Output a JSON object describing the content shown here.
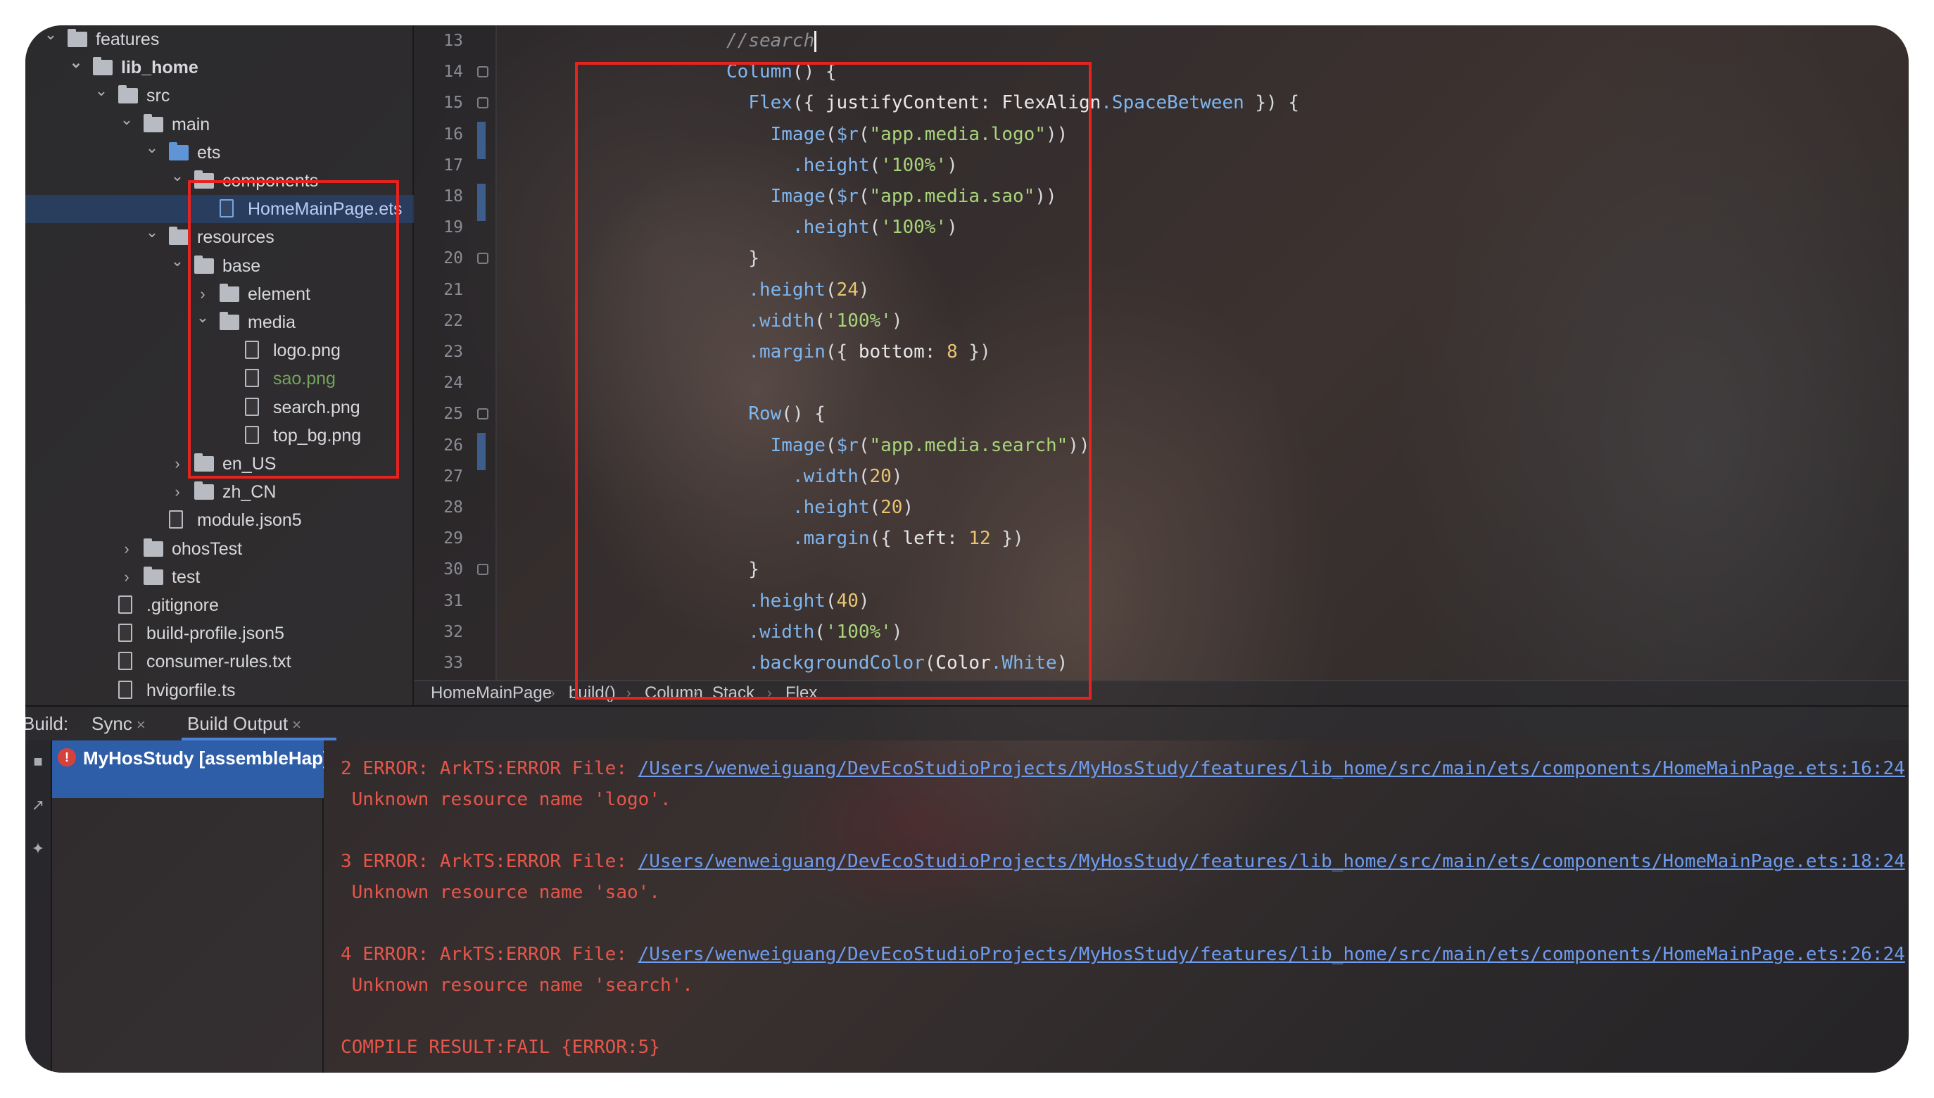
{
  "project_tree": {
    "items": [
      {
        "label": "features",
        "kind": "folder",
        "chev": "down"
      },
      {
        "label": "lib_home",
        "kind": "module-folder",
        "chev": "down"
      },
      {
        "label": "src",
        "kind": "folder",
        "chev": "down"
      },
      {
        "label": "main",
        "kind": "folder",
        "chev": "down"
      },
      {
        "label": "ets",
        "kind": "blue-folder",
        "chev": "down"
      },
      {
        "label": "components",
        "kind": "folder",
        "chev": "down"
      },
      {
        "label": "HomeMainPage.ets",
        "kind": "ets-file",
        "chev": ""
      },
      {
        "label": "resources",
        "kind": "folder",
        "chev": "down"
      },
      {
        "label": "base",
        "kind": "folder",
        "chev": "down"
      },
      {
        "label": "element",
        "kind": "folder",
        "chev": "right"
      },
      {
        "label": "media",
        "kind": "folder",
        "chev": "down"
      },
      {
        "label": "logo.png",
        "kind": "file",
        "chev": ""
      },
      {
        "label": "sao.png",
        "kind": "file",
        "chev": ""
      },
      {
        "label": "search.png",
        "kind": "file",
        "chev": ""
      },
      {
        "label": "top_bg.png",
        "kind": "file",
        "chev": ""
      },
      {
        "label": "en_US",
        "kind": "folder",
        "chev": "right"
      },
      {
        "label": "zh_CN",
        "kind": "folder",
        "chev": "right"
      },
      {
        "label": "module.json5",
        "kind": "file",
        "chev": ""
      },
      {
        "label": "ohosTest",
        "kind": "folder",
        "chev": "right"
      },
      {
        "label": "test",
        "kind": "folder",
        "chev": "right"
      },
      {
        "label": ".gitignore",
        "kind": "file",
        "chev": ""
      },
      {
        "label": "build-profile.json5",
        "kind": "file",
        "chev": ""
      },
      {
        "label": "consumer-rules.txt",
        "kind": "file",
        "chev": ""
      },
      {
        "label": "hvigorfile.ts",
        "kind": "file",
        "chev": ""
      }
    ]
  },
  "editor": {
    "line_numbers": [
      "13",
      "14",
      "15",
      "16",
      "17",
      "18",
      "19",
      "20",
      "21",
      "22",
      "23",
      "24",
      "25",
      "26",
      "27",
      "28",
      "29",
      "30",
      "31",
      "32",
      "33"
    ],
    "lines": [
      "//search",
      "Column() {",
      "  Flex({ justifyContent: FlexAlign.SpaceBetween }) {",
      "    Image($r(\"app.media.logo\"))",
      "      .height('100%')",
      "    Image($r(\"app.media.sao\"))",
      "      .height('100%')",
      "  }",
      "  .height(24)",
      "  .width('100%')",
      "  .margin({ bottom: 8 })",
      "",
      "  Row() {",
      "    Image($r(\"app.media.search\"))",
      "      .width(20)",
      "      .height(20)",
      "      .margin({ left: 12 })",
      "  }",
      "  .height(40)",
      "  .width('100%')",
      "  .backgroundColor(Color.White)"
    ]
  },
  "breadcrumb": [
    "HomeMainPage",
    "build()",
    "Column",
    "Stack",
    "Flex"
  ],
  "build_window": {
    "tabs": {
      "build_label": "Build:",
      "sync": "Sync",
      "build_output": "Build Output",
      "close": "×"
    },
    "task_label": "MyHosStudy [assembleHap]",
    "error_icon": "!",
    "console": {
      "errors": [
        {
          "prefix": "2 ERROR: ArkTS:ERROR File: ",
          "link": "/Users/wenweiguang/DevEcoStudioProjects/MyHosStudy/features/lib_home/src/main/ets/components/HomeMainPage.ets:16:24",
          "message": " Unknown resource name 'logo'."
        },
        {
          "prefix": "3 ERROR: ArkTS:ERROR File: ",
          "link": "/Users/wenweiguang/DevEcoStudioProjects/MyHosStudy/features/lib_home/src/main/ets/components/HomeMainPage.ets:18:24",
          "message": " Unknown resource name 'sao'."
        },
        {
          "prefix": "4 ERROR: ArkTS:ERROR File: ",
          "link": "/Users/wenweiguang/DevEcoStudioProjects/MyHosStudy/features/lib_home/src/main/ets/components/HomeMainPage.ets:26:24",
          "message": " Unknown resource name 'search'."
        }
      ],
      "result": "COMPILE RESULT:FAIL {ERROR:5}"
    }
  },
  "colors": {
    "highlight_box": "#e6231f",
    "selection": "#2f5ea8",
    "error_text": "#e5564b",
    "link": "#6d9cf0"
  },
  "icons": {
    "folder": "folder-icon",
    "file": "file-icon",
    "expand": "chevron-down-icon",
    "collapse": "chevron-right-icon",
    "sidebar": [
      "stop-icon",
      "external-link-icon",
      "pin-icon"
    ]
  }
}
